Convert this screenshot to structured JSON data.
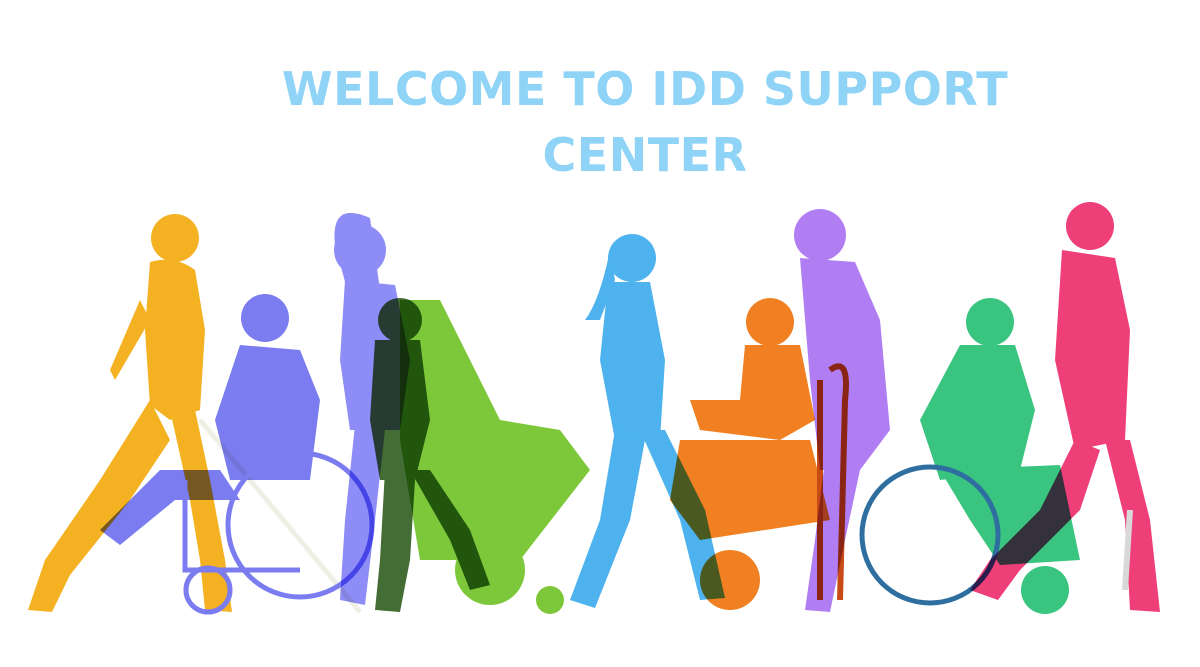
{
  "banner": {
    "title_line1": "WELCOME TO IDD SUPPORT",
    "title_line2": "CENTER"
  },
  "colors": {
    "title": "#8fd3f7",
    "background": "#ffffff",
    "yellow": "#f4b223",
    "blue_violet": "#7a7cf0",
    "lavender": "#8e8cf6",
    "dark_green": "#2e5d1e",
    "lime_green": "#7cc83a",
    "sky_blue": "#4db2ee",
    "orange": "#f08022",
    "purple": "#b07ef2",
    "teal_green": "#39c47f",
    "pink": "#ee3f78"
  },
  "illustration": {
    "description_icons": [
      "person-walking-icon",
      "wheelchair-user-icon",
      "white-cane-icon"
    ]
  }
}
